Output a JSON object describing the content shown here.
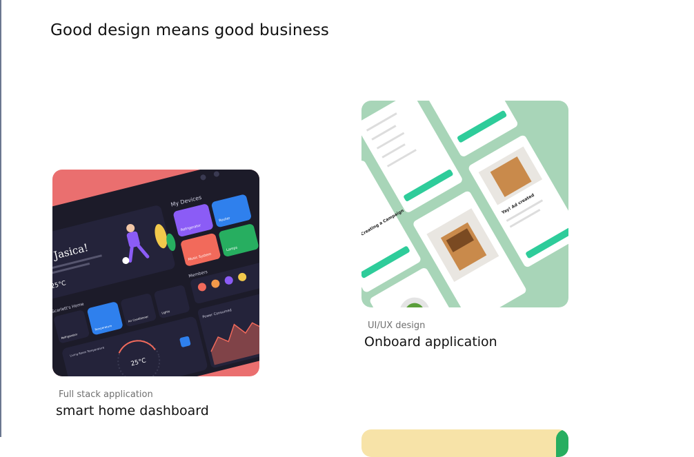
{
  "page": {
    "heading": "Good design means good business"
  },
  "projects": [
    {
      "category": "Full stack application",
      "title": "smart home dashboard",
      "preview": {
        "greeting": "Hi Jasica!",
        "my_devices": "My Devices",
        "devices": [
          "Refrigerator",
          "Router",
          "Music System",
          "Lamps"
        ],
        "members_label": "Members",
        "smart_home_label": "Scarlett's Home",
        "tiles": [
          "Refrigerator",
          "Temperature",
          "Air Conditioner",
          "Lights"
        ],
        "temp_reading": "25°C",
        "power_label": "Power Consumed",
        "thermostat_label": "Living Room Temperature",
        "accent": "#ea6f6f"
      }
    },
    {
      "category": "UI/UX design",
      "title": "Onboard application",
      "preview": {
        "screen_text": "Start by Creating a Campaign",
        "ad_text": "Yay! Ad created",
        "accent": "#a8d5b8"
      }
    }
  ]
}
